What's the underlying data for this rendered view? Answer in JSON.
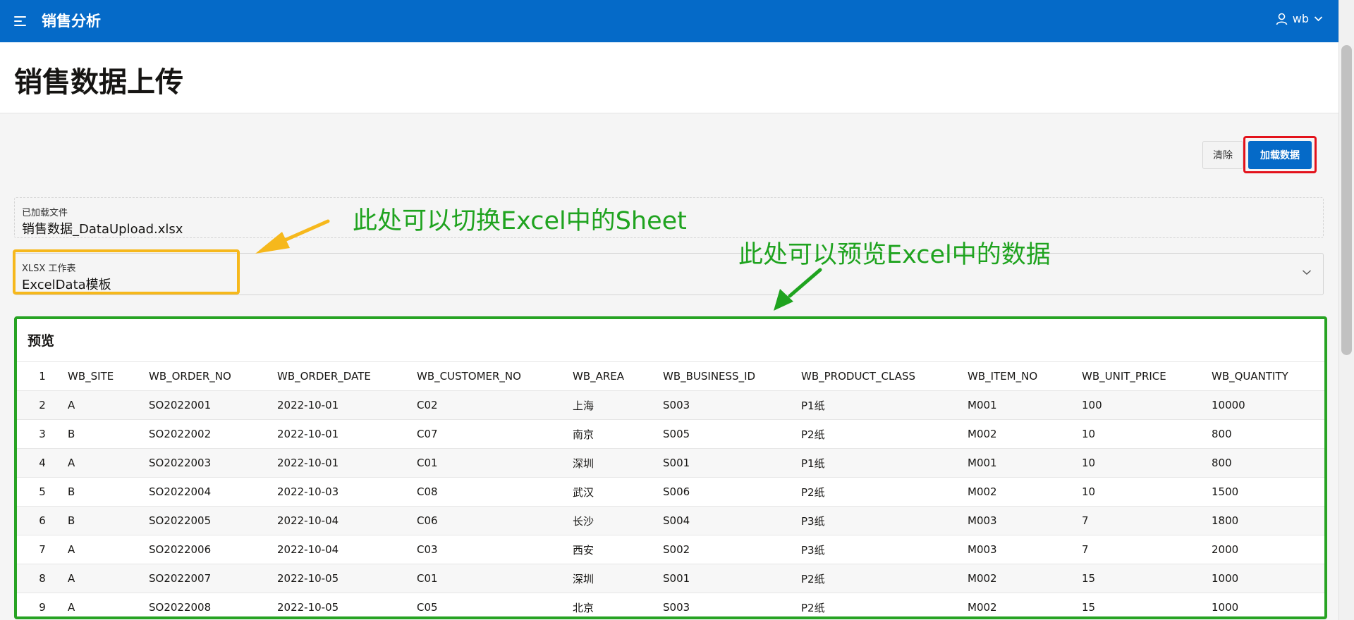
{
  "header": {
    "app_title": "销售分析",
    "user_name": "wb"
  },
  "page": {
    "title": "销售数据上传"
  },
  "toolbar": {
    "clear_label": "清除",
    "load_label": "加载数据"
  },
  "loaded_file": {
    "label": "已加载文件",
    "value": "销售数据_DataUpload.xlsx"
  },
  "sheet_select": {
    "label": "XLSX 工作表",
    "value": "ExcelData模板"
  },
  "annotations": {
    "sheet_note": "此处可以切换Excel中的Sheet",
    "preview_note": "此处可以预览Excel中的数据"
  },
  "preview": {
    "title": "预览",
    "rows": [
      [
        "1",
        "WB_SITE",
        "WB_ORDER_NO",
        "WB_ORDER_DATE",
        "WB_CUSTOMER_NO",
        "WB_AREA",
        "WB_BUSINESS_ID",
        "WB_PRODUCT_CLASS",
        "WB_ITEM_NO",
        "WB_UNIT_PRICE",
        "WB_QUANTITY"
      ],
      [
        "2",
        "A",
        "SO2022001",
        "2022-10-01",
        "C02",
        "上海",
        "S003",
        "P1纸",
        "M001",
        "100",
        "10000"
      ],
      [
        "3",
        "B",
        "SO2022002",
        "2022-10-01",
        "C07",
        "南京",
        "S005",
        "P2纸",
        "M002",
        "10",
        "800"
      ],
      [
        "4",
        "A",
        "SO2022003",
        "2022-10-01",
        "C01",
        "深圳",
        "S001",
        "P1纸",
        "M001",
        "10",
        "800"
      ],
      [
        "5",
        "B",
        "SO2022004",
        "2022-10-03",
        "C08",
        "武汉",
        "S006",
        "P2纸",
        "M002",
        "10",
        "1500"
      ],
      [
        "6",
        "B",
        "SO2022005",
        "2022-10-04",
        "C06",
        "长沙",
        "S004",
        "P3纸",
        "M003",
        "7",
        "1800"
      ],
      [
        "7",
        "A",
        "SO2022006",
        "2022-10-04",
        "C03",
        "西安",
        "S002",
        "P3纸",
        "M003",
        "7",
        "2000"
      ],
      [
        "8",
        "A",
        "SO2022007",
        "2022-10-05",
        "C01",
        "深圳",
        "S001",
        "P2纸",
        "M002",
        "15",
        "1000"
      ],
      [
        "9",
        "A",
        "SO2022008",
        "2022-10-05",
        "C05",
        "北京",
        "S003",
        "P2纸",
        "M002",
        "15",
        "1000"
      ]
    ]
  },
  "colors": {
    "header_bg": "#056ac8",
    "primary_button": "#056ac8",
    "annotation_text": "#1fa31f",
    "highlight_red": "#e3121b",
    "highlight_yellow": "#f6b81c",
    "highlight_green": "#27a323"
  },
  "icons": {
    "menu": "hamburger-menu-icon",
    "user": "user-icon",
    "user_chevron": "chevron-down-icon",
    "select_chevron": "chevron-down-icon"
  }
}
